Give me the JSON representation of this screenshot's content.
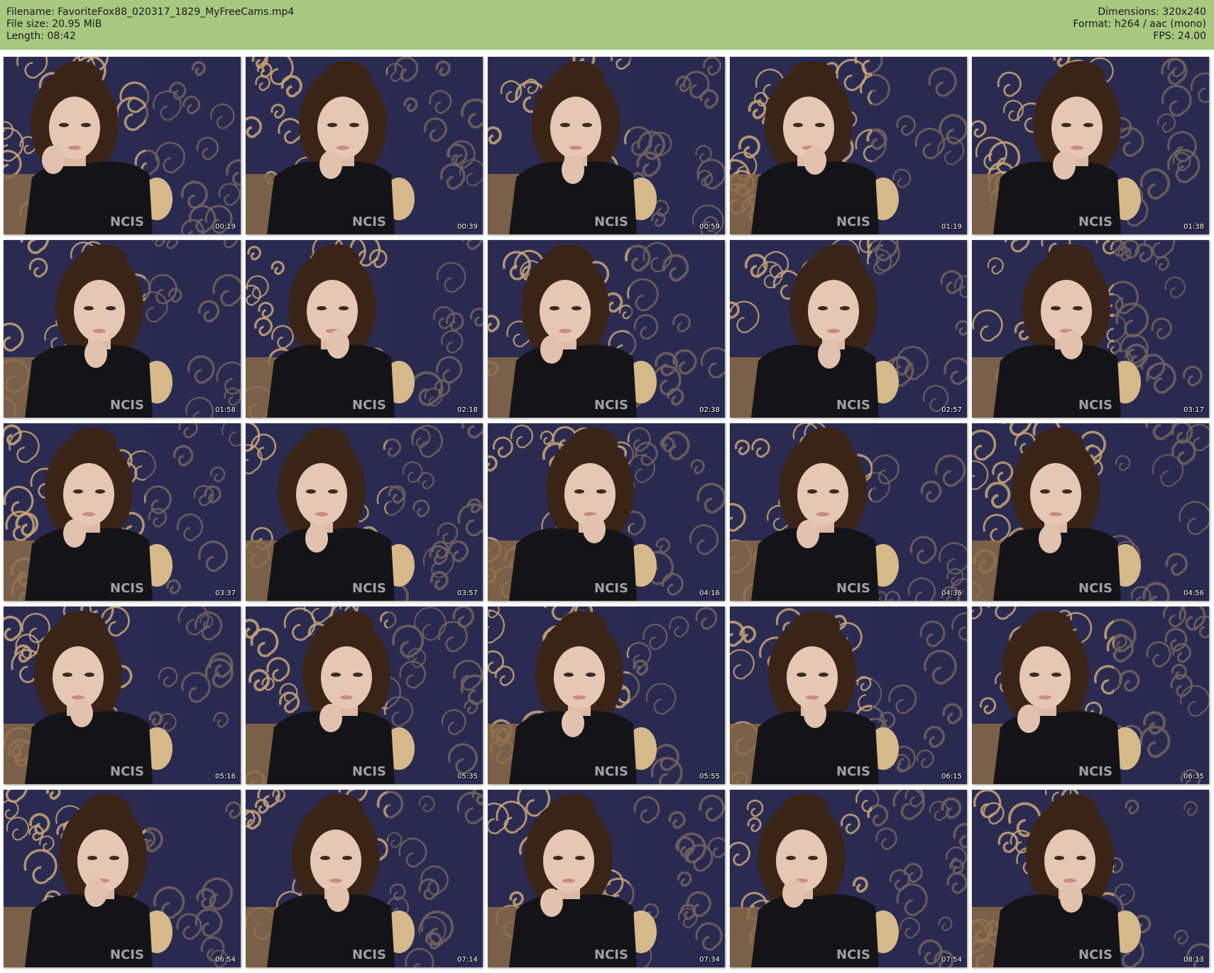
{
  "header": {
    "filename_line": "Filename: FavoriteFox88_020317_1829_MyFreeCams.mp4",
    "filesize_line": "File size: 20.95 MiB",
    "length_line": "Length: 08:42",
    "dimensions_line": "Dimensions: 320x240",
    "format_line": "Format: h264 / aac (mono)",
    "fps_line": "FPS: 24.00",
    "background_color": "#a7c880"
  },
  "thumbnails": [
    {
      "timestamp": "00:19"
    },
    {
      "timestamp": "00:39"
    },
    {
      "timestamp": "00:59"
    },
    {
      "timestamp": "01:19"
    },
    {
      "timestamp": "01:38"
    },
    {
      "timestamp": "01:58"
    },
    {
      "timestamp": "02:18"
    },
    {
      "timestamp": "02:38"
    },
    {
      "timestamp": "02:57"
    },
    {
      "timestamp": "03:17"
    },
    {
      "timestamp": "03:37"
    },
    {
      "timestamp": "03:57"
    },
    {
      "timestamp": "04:16"
    },
    {
      "timestamp": "04:36"
    },
    {
      "timestamp": "04:56"
    },
    {
      "timestamp": "05:16"
    },
    {
      "timestamp": "05:35"
    },
    {
      "timestamp": "05:55"
    },
    {
      "timestamp": "06:15"
    },
    {
      "timestamp": "06:35"
    },
    {
      "timestamp": "06:54"
    },
    {
      "timestamp": "07:14"
    },
    {
      "timestamp": "07:34"
    },
    {
      "timestamp": "07:54"
    },
    {
      "timestamp": "08:13"
    }
  ],
  "colors": {
    "wallpaper_dark": "#2b2b52",
    "wallpaper_swirl": "#c9a777",
    "shirt": "#141418",
    "hair": "#3a2418",
    "skin": "#e6c7b4"
  }
}
